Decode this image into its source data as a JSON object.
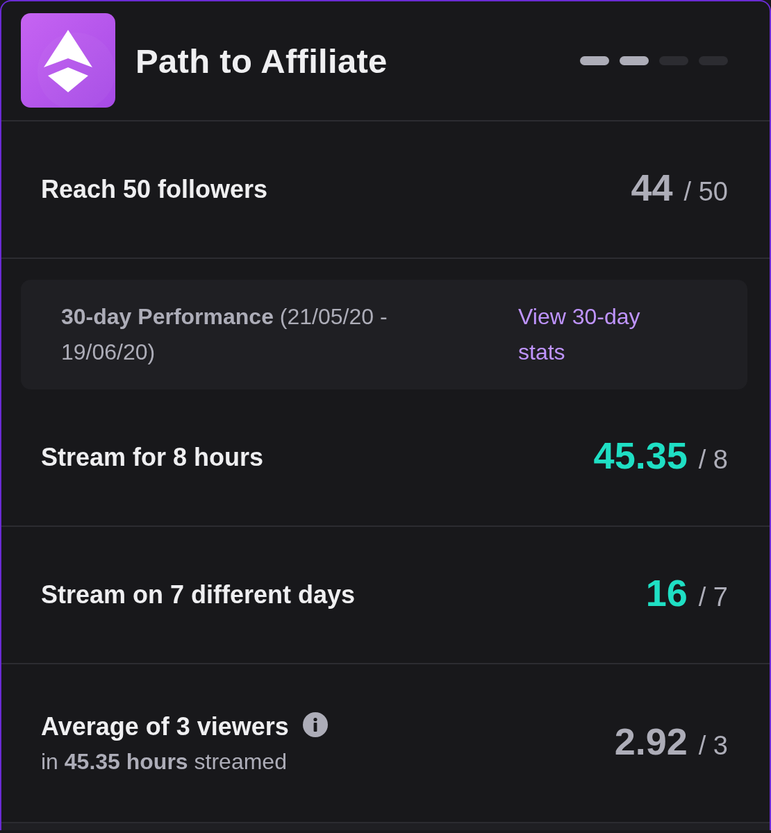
{
  "header": {
    "title": "Path to Affiliate",
    "steps": [
      {
        "complete": true
      },
      {
        "complete": true
      },
      {
        "complete": false
      },
      {
        "complete": false
      }
    ]
  },
  "items": [
    {
      "kind": "requirement",
      "label": "Reach 50 followers",
      "info": false,
      "value": "44",
      "goal": "/ 50",
      "met": false
    },
    {
      "kind": "performance",
      "text": "**30-day Performance** (21/05/20 - 19/06/20)",
      "link": "View 30-day stats"
    },
    {
      "kind": "requirement",
      "label": "Stream for 8 hours",
      "info": false,
      "value": "45.35",
      "goal": "/ 8",
      "met": true
    },
    {
      "kind": "requirement",
      "label": "Stream on 7 different days",
      "info": false,
      "value": "16",
      "goal": "/ 7",
      "met": true
    },
    {
      "kind": "requirement",
      "label": "Average of 3 viewers",
      "info": true,
      "detail": "in **45.35 hours** streamed",
      "value": "2.92",
      "goal": "/ 3",
      "met": false
    }
  ]
}
